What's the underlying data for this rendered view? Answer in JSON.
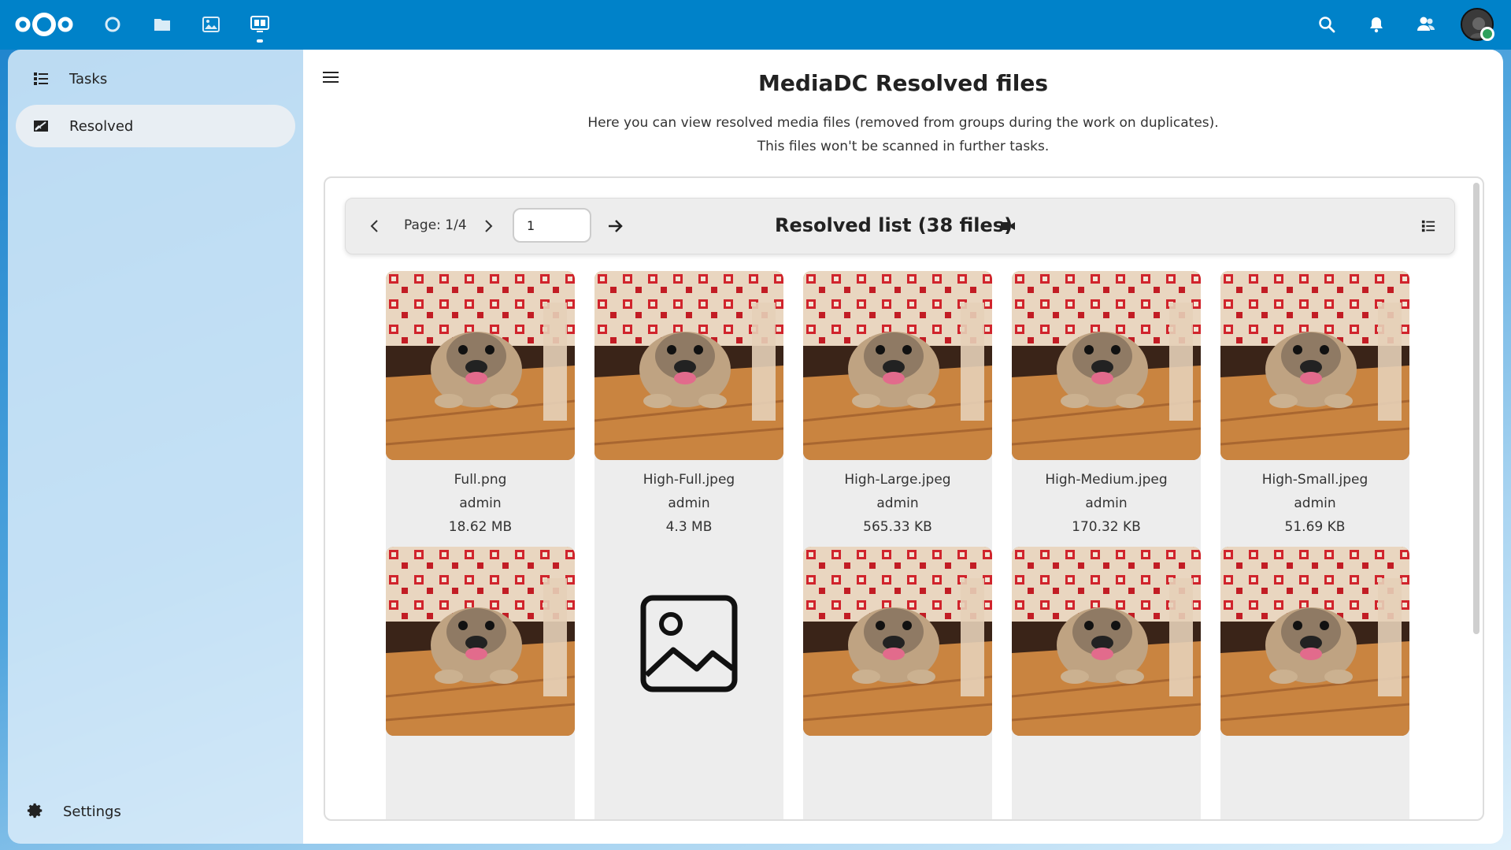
{
  "topbar": {
    "logo": "nextcloud-logo",
    "apps": [
      "dashboard-icon",
      "files-icon",
      "photos-icon",
      "mediadc-icon"
    ],
    "right_icons": [
      "search-icon",
      "notifications-icon",
      "contacts-icon"
    ]
  },
  "sidebar": {
    "items": [
      {
        "label": "Tasks",
        "icon": "tasks-list-icon"
      },
      {
        "label": "Resolved",
        "icon": "resolved-icon"
      }
    ],
    "settings_label": "Settings"
  },
  "main": {
    "title": "MediaDC Resolved files",
    "description_line1": "Here you can view resolved media files (removed from groups during the work on duplicates).",
    "description_line2": "This files won't be scanned in further tasks."
  },
  "toolbar": {
    "page_label": "Page: 1/4",
    "page_input_value": "1",
    "list_title": "Resolved list (38 files)"
  },
  "files": [
    {
      "name": "Full.png",
      "owner": "admin",
      "size": "18.62 MB"
    },
    {
      "name": "High-Full.jpeg",
      "owner": "admin",
      "size": "4.3 MB"
    },
    {
      "name": "High-Large.jpeg",
      "owner": "admin",
      "size": "565.33 KB"
    },
    {
      "name": "High-Medium.jpeg",
      "owner": "admin",
      "size": "170.32 KB"
    },
    {
      "name": "High-Small.jpeg",
      "owner": "admin",
      "size": "51.69 KB"
    }
  ],
  "colors": {
    "header": "#0082c9",
    "card": "#ededed"
  }
}
